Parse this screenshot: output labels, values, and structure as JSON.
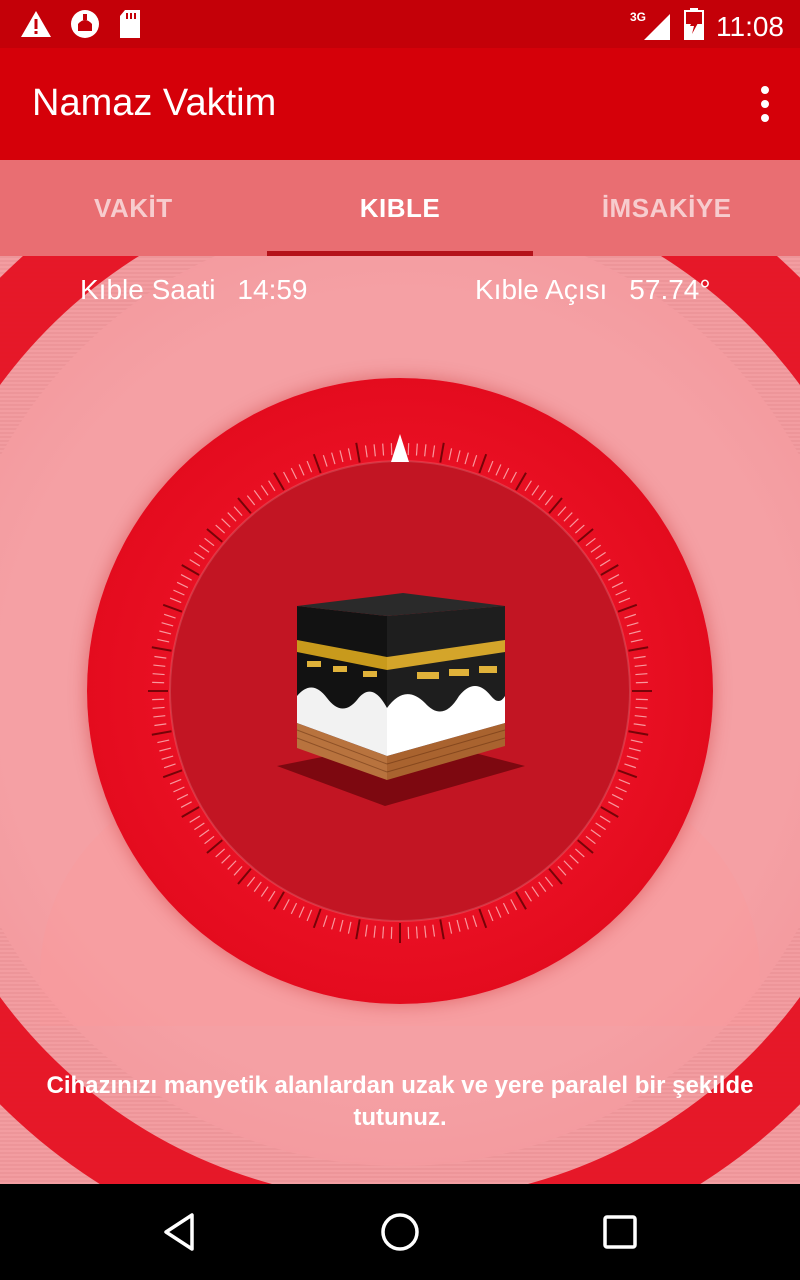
{
  "status_bar": {
    "time": "11:08",
    "network": "3G",
    "icons": [
      "warning-icon",
      "mosque-notification-icon",
      "sd-card-icon",
      "signal-icon",
      "battery-icon"
    ]
  },
  "app_bar": {
    "title": "Namaz Vaktim",
    "menu_icon": "more-vert-icon"
  },
  "tabs": [
    {
      "label": "VAKİT",
      "active": false
    },
    {
      "label": "KIBLE",
      "active": true
    },
    {
      "label": "İMSAKİYE",
      "active": false
    }
  ],
  "qibla": {
    "time_label": "Kıble Saati",
    "time_value": "14:59",
    "angle_label": "Kıble Açısı",
    "angle_value": "57.74°"
  },
  "hint_text": "Cihazınızı manyetik alanlardan uzak ve yere paralel bir şekilde tutunuz.",
  "colors": {
    "status_bar": "#c40008",
    "app_bar": "#d50009",
    "tab_bar": "#e96e72",
    "compass": "#e80f22",
    "compass_face": "#c21523"
  },
  "nav_bar": {
    "buttons": [
      "back-icon",
      "home-icon",
      "recents-icon"
    ]
  }
}
